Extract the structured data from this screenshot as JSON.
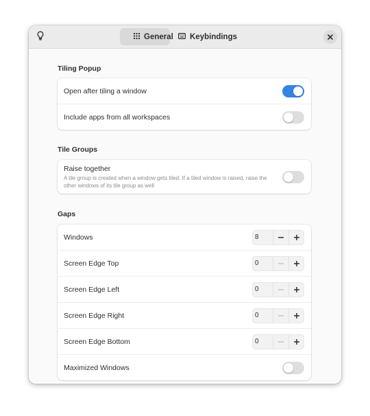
{
  "header": {
    "tabs": [
      {
        "label": "General",
        "icon": "grid-icon",
        "active": true
      },
      {
        "label": "Keybindings",
        "icon": "keyboard-icon",
        "active": false
      }
    ]
  },
  "sections": {
    "tiling_popup": {
      "title": "Tiling Popup",
      "rows": [
        {
          "label": "Open after tiling a window",
          "enabled": true
        },
        {
          "label": "Include apps from all workspaces",
          "enabled": false
        }
      ]
    },
    "tile_groups": {
      "title": "Tile Groups",
      "rows": [
        {
          "label": "Raise together",
          "subtitle": "A tile group is created when a window gets tiled. If a tiled window is raised, raise the other windows of its tile group as well",
          "enabled": false
        }
      ]
    },
    "gaps": {
      "title": "Gaps",
      "rows": [
        {
          "label": "Windows",
          "value": "8"
        },
        {
          "label": "Screen Edge Top",
          "value": "0"
        },
        {
          "label": "Screen Edge Left",
          "value": "0"
        },
        {
          "label": "Screen Edge Right",
          "value": "0"
        },
        {
          "label": "Screen Edge Bottom",
          "value": "0"
        },
        {
          "label": "Maximized Windows",
          "enabled": false
        }
      ]
    }
  },
  "colors": {
    "accent": "#3584e4",
    "switch_off": "#dedede"
  }
}
